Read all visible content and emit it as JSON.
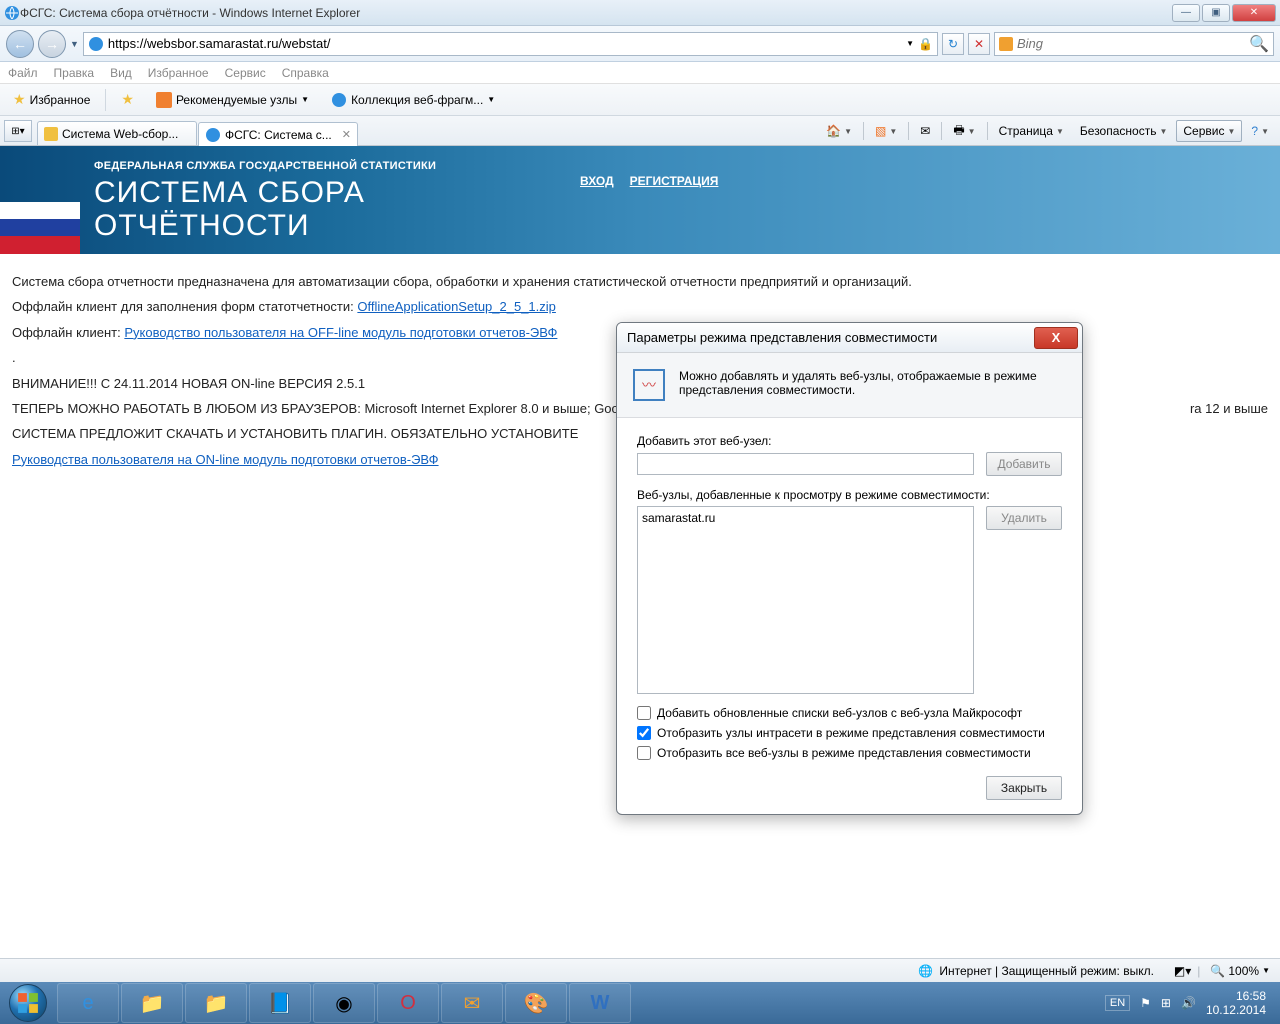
{
  "window": {
    "title": "ФСГС: Система сбора отчётности - Windows Internet Explorer"
  },
  "nav": {
    "url": "https://websbor.samarastat.ru/webstat/",
    "search_placeholder": "Bing"
  },
  "menu": [
    "Файл",
    "Правка",
    "Вид",
    "Избранное",
    "Сервис",
    "Справка"
  ],
  "favbar": {
    "favorites": "Избранное",
    "recommended": "Рекомендуемые узлы",
    "webfrag": "Коллекция веб-фрагм..."
  },
  "tabs": [
    {
      "label": "Система Web-сбор..."
    },
    {
      "label": "ФСГС: Система с..."
    }
  ],
  "cmdbar": {
    "page": "Страница",
    "safety": "Безопасность",
    "service": "Сервис"
  },
  "banner": {
    "sub": "ФЕДЕРАЛЬНАЯ СЛУЖБА ГОСУДАРСТВЕННОЙ СТАТИСТИКИ",
    "line1": "СИСТЕМА СБОРА",
    "line2": "ОТЧЁТНОСТИ",
    "login": "ВХОД",
    "register": "РЕГИСТРАЦИЯ"
  },
  "content": {
    "p1": "Система сбора отчетности предназначена для автоматизации сбора, обработки и хранения статистической отчетности предприятий и организаций.",
    "p2_pre": "Оффлайн клиент для заполнения форм статотчетности: ",
    "p2_link": "OfflineApplicationSetup_2_5_1.zip",
    "p3_pre": "Оффлайн клиент: ",
    "p3_link": "Руководство пользователя на OFF-line модуль подготовки отчетов-ЭВФ",
    "p4": "ВНИМАНИЕ!!! С 24.11.2014 НОВАЯ ON-line ВЕРСИЯ 2.5.1",
    "p5a": "ТЕПЕРЬ МОЖНО РАБОТАТЬ В ЛЮБОМ ИЗ БРАУЗЕРОВ: Microsoft Internet Explorer 8.0 и выше; Goo",
    "p5b": "ra 12 и выше",
    "p6": "СИСТЕМА ПРЕДЛОЖИТ СКАЧАТЬ И УСТАНОВИТЬ ПЛАГИН. ОБЯЗАТЕЛЬНО УСТАНОВИТЕ",
    "p7_link": "Руководства пользователя на ON-line модуль подготовки отчетов-ЭВФ"
  },
  "dialog": {
    "title": "Параметры режима представления совместимости",
    "info": "Можно добавлять и удалять веб-узлы, отображаемые в режиме представления совместимости.",
    "add_label": "Добавить этот веб-узел:",
    "add_btn": "Добавить",
    "list_label": "Веб-узлы, добавленные к просмотру в режиме совместимости:",
    "list_item": "samarastat.ru",
    "del_btn": "Удалить",
    "chk1": "Добавить обновленные списки веб-узлов с веб-узла Майкрософт",
    "chk2": "Отобразить узлы интрасети в режиме представления совместимости",
    "chk3": "Отобразить все веб-узлы в режиме представления совместимости",
    "close_btn": "Закрыть"
  },
  "status": {
    "mode": "Интернет | Защищенный режим: выкл.",
    "zoom": "100%"
  },
  "tray": {
    "lang": "EN",
    "time": "16:58",
    "date": "10.12.2014"
  }
}
